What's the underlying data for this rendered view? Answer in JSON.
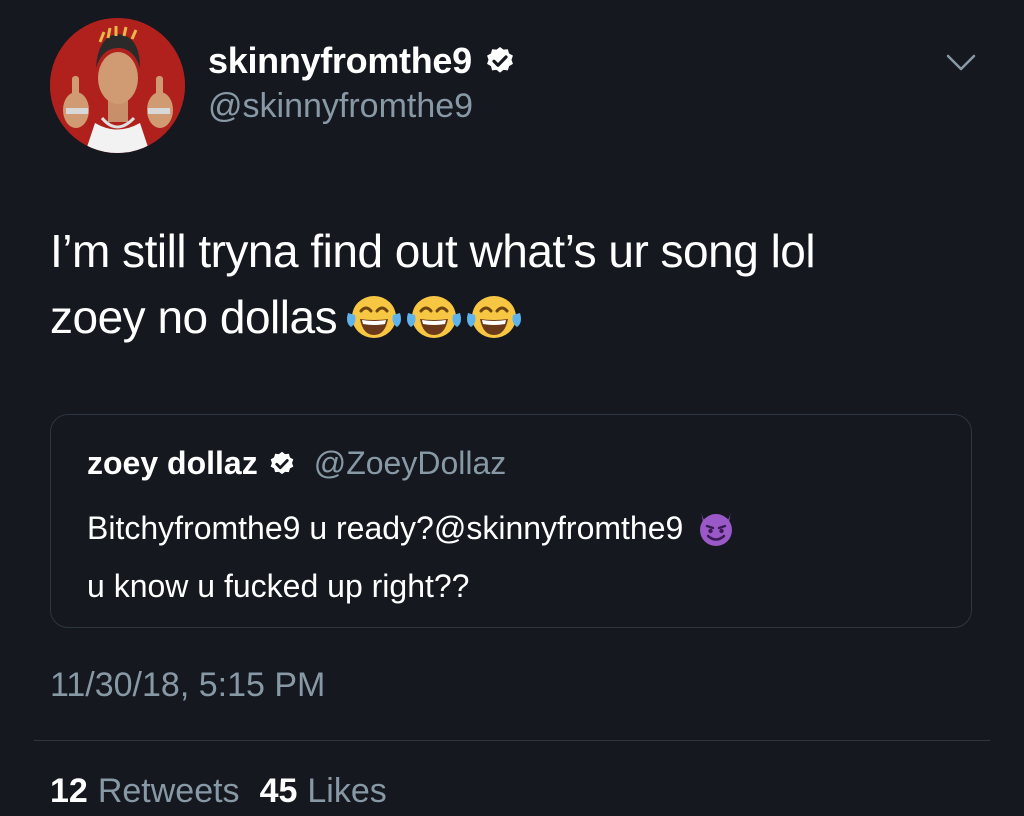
{
  "tweet": {
    "author": {
      "display_name": "skinnyfromthe9",
      "handle": "@skinnyfromthe9",
      "verified": true
    },
    "text_line1": "I’m still tryna find out what’s ur song lol",
    "text_line2": "zoey no dollas",
    "emojis": [
      "face-with-tears-of-joy",
      "face-with-tears-of-joy",
      "face-with-tears-of-joy"
    ],
    "quoted_tweet": {
      "display_name": "zoey dollaz",
      "handle": "@ZoeyDollaz",
      "verified": true,
      "text_line1": "Bitchyfromthe9 u ready?@skinnyfromthe9",
      "text_line2": "u know u fucked up right??",
      "emoji": "smiling-face-with-horns"
    },
    "timestamp": "11/30/18, 5:15 PM",
    "stats": {
      "retweets_count": "12",
      "retweets_label": "Retweets",
      "likes_count": "45",
      "likes_label": "Likes"
    }
  },
  "colors": {
    "background": "#15181f",
    "primary_text": "#ffffff",
    "secondary_text": "#8899a6",
    "border": "#2d3641",
    "avatar_background": "#b0201c"
  }
}
